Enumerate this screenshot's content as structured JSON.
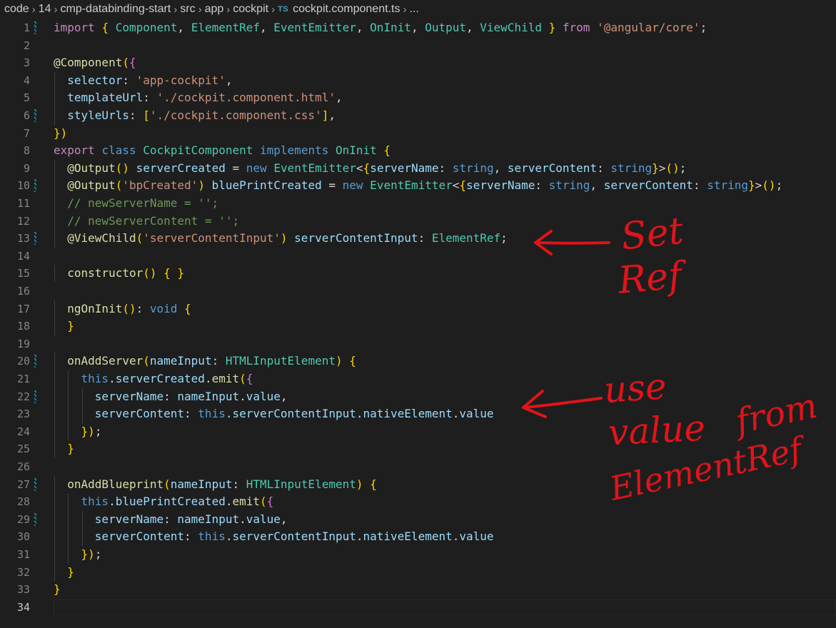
{
  "breadcrumb": {
    "items": [
      "code",
      "14",
      "cmp-databinding-start",
      "src",
      "app",
      "cockpit"
    ],
    "file_type_badge": "TS",
    "file_name": "cockpit.component.ts",
    "ellipsis": "..."
  },
  "editor": {
    "language": "typescript",
    "current_line": 34,
    "modified_lines": [
      1,
      6,
      10,
      13,
      20,
      22,
      27,
      29
    ],
    "lines": [
      {
        "n": 1,
        "text": "import { Component, ElementRef, EventEmitter, OnInit, Output, ViewChild } from '@angular/core';"
      },
      {
        "n": 2,
        "text": ""
      },
      {
        "n": 3,
        "text": "@Component({"
      },
      {
        "n": 4,
        "text": "  selector: 'app-cockpit',"
      },
      {
        "n": 5,
        "text": "  templateUrl: './cockpit.component.html',"
      },
      {
        "n": 6,
        "text": "  styleUrls: ['./cockpit.component.css'],"
      },
      {
        "n": 7,
        "text": "})"
      },
      {
        "n": 8,
        "text": "export class CockpitComponent implements OnInit {"
      },
      {
        "n": 9,
        "text": "  @Output() serverCreated = new EventEmitter<{serverName: string, serverContent: string}>();"
      },
      {
        "n": 10,
        "text": "  @Output('bpCreated') bluePrintCreated = new EventEmitter<{serverName: string, serverContent: string}>();"
      },
      {
        "n": 11,
        "text": "  // newServerName = '';"
      },
      {
        "n": 12,
        "text": "  // newServerContent = '';"
      },
      {
        "n": 13,
        "text": "  @ViewChild('serverContentInput') serverContentInput: ElementRef;"
      },
      {
        "n": 14,
        "text": ""
      },
      {
        "n": 15,
        "text": "  constructor() { }"
      },
      {
        "n": 16,
        "text": ""
      },
      {
        "n": 17,
        "text": "  ngOnInit(): void {"
      },
      {
        "n": 18,
        "text": "  }"
      },
      {
        "n": 19,
        "text": ""
      },
      {
        "n": 20,
        "text": "  onAddServer(nameInput: HTMLInputElement) {"
      },
      {
        "n": 21,
        "text": "    this.serverCreated.emit({"
      },
      {
        "n": 22,
        "text": "      serverName: nameInput.value,"
      },
      {
        "n": 23,
        "text": "      serverContent: this.serverContentInput.nativeElement.value"
      },
      {
        "n": 24,
        "text": "    });"
      },
      {
        "n": 25,
        "text": "  }"
      },
      {
        "n": 26,
        "text": ""
      },
      {
        "n": 27,
        "text": "  onAddBlueprint(nameInput: HTMLInputElement) {"
      },
      {
        "n": 28,
        "text": "    this.bluePrintCreated.emit({"
      },
      {
        "n": 29,
        "text": "      serverName: nameInput.value,"
      },
      {
        "n": 30,
        "text": "      serverContent: this.serverContentInput.nativeElement.value"
      },
      {
        "n": 31,
        "text": "    });"
      },
      {
        "n": 32,
        "text": "  }"
      },
      {
        "n": 33,
        "text": "}"
      },
      {
        "n": 34,
        "text": ""
      }
    ]
  },
  "annotations": {
    "color": "#e0141a",
    "note_set_ref": [
      "Set",
      "Ref"
    ],
    "note_use_value": [
      "use",
      "value",
      "from",
      "ElementRef"
    ]
  },
  "colors": {
    "background": "#1e1e1e",
    "keyword": "#569cd6",
    "control": "#c586c0",
    "type": "#4ec9b0",
    "function": "#dcdcaa",
    "variable": "#9cdcfe",
    "string": "#ce9178",
    "comment": "#6a9955"
  }
}
